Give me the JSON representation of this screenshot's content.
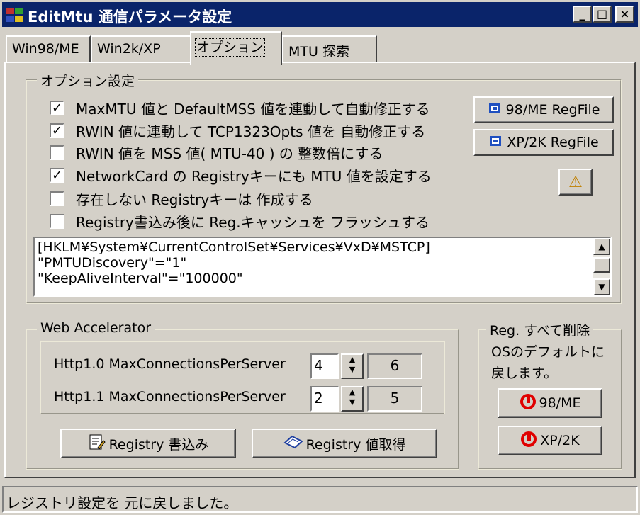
{
  "window": {
    "title": "EditMtu  通信パラメータ設定",
    "minimize": "_",
    "maximize": "□",
    "close": "×"
  },
  "tabs": [
    {
      "label": "Win98/ME"
    },
    {
      "label": "Win2k/XP"
    },
    {
      "label": "オプション"
    },
    {
      "label": "MTU 探索"
    }
  ],
  "options_group": {
    "title": "オプション設定",
    "checkboxes": [
      {
        "label": "MaxMTU 値と DefaultMSS 値を連動して自動修正する",
        "mark": "✓"
      },
      {
        "label": "RWIN 値に連動して TCP1323Opts 値を 自動修正する",
        "mark": "✓"
      },
      {
        "label": "RWIN 値を MSS 値( MTU-40 ) の 整数倍にする",
        "mark": ""
      },
      {
        "label": "NetworkCard の Registryキーにも MTU 値を設定する",
        "mark": "✓"
      },
      {
        "label": "存在しない Registryキーは 作成する",
        "mark": ""
      },
      {
        "label": "Registry書込み後に Reg.キャッシュを フラッシュする",
        "mark": ""
      }
    ],
    "btn_98me": "98/ME RegFile",
    "btn_xp2k": "XP/2K RegFile",
    "help_icon": "⚠",
    "reg_text": [
      "[HKLM¥System¥CurrentControlSet¥Services¥VxD¥MSTCP]",
      "\"PMTUDiscovery\"=\"1\"",
      "\"KeepAliveInterval\"=\"100000\""
    ]
  },
  "web_accel": {
    "title": "Web Accelerator",
    "http10_label": "Http1.0 MaxConnectionsPerServer",
    "http10_value": "4",
    "http10_current": "6",
    "http11_label": "Http1.1 MaxConnectionsPerServer",
    "http11_value": "2",
    "http11_current": "5",
    "write_button": "Registry 書込み",
    "read_button": "Registry 値取得"
  },
  "reg_reset": {
    "title": "Reg. すべて削除",
    "desc_line1": "OSのデフォルトに",
    "desc_line2": "戻します。",
    "btn_98me": "98/ME",
    "btn_xp2k": "XP/2K"
  },
  "status": {
    "text": "レジストリ設定を 元に戻しました。"
  }
}
